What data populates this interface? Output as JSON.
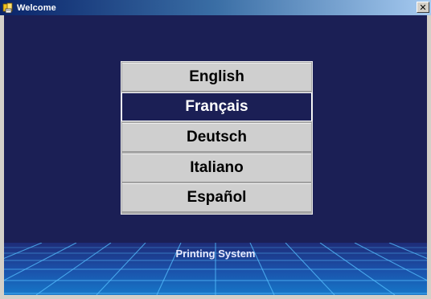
{
  "window": {
    "title": "Welcome",
    "close_glyph": "✕"
  },
  "languages": [
    {
      "label": "English",
      "selected": false
    },
    {
      "label": "Français",
      "selected": true
    },
    {
      "label": "Deutsch",
      "selected": false
    },
    {
      "label": "Italiano",
      "selected": false
    },
    {
      "label": "Español",
      "selected": false
    }
  ],
  "footer": {
    "text": "Printing System"
  },
  "colors": {
    "background": "#1b1f55",
    "selected_bg": "#1b1f55",
    "item_bg": "#cfcfcf",
    "grid_glow": "#4fb6ff"
  },
  "icons": {
    "title_icon": "app-book-icon",
    "close_icon": "close-icon"
  }
}
